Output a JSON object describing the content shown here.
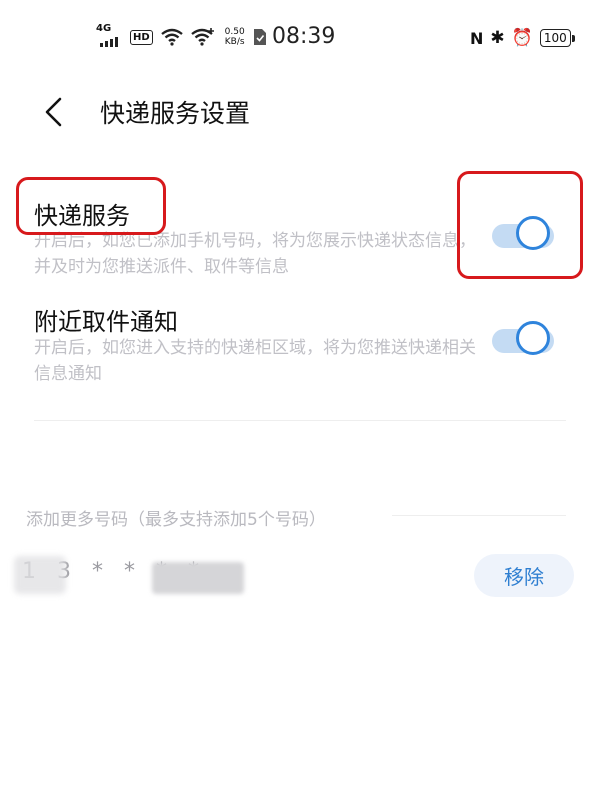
{
  "status_bar": {
    "network_type": "4G",
    "hd_badge": "HD",
    "speed_value": "0.50",
    "speed_unit": "KB/s",
    "time": "08:39",
    "battery_level": "100",
    "icons": [
      "signal-icon",
      "wifi-icon",
      "wifi-plus-icon",
      "sim-card-icon",
      "nfc-icon",
      "bluetooth-icon",
      "alarm-icon",
      "battery-icon"
    ]
  },
  "header": {
    "back_icon": "chevron-left-icon",
    "title": "快递服务设置"
  },
  "settings": [
    {
      "title": "快递服务",
      "description": "开启后，如您已添加手机号码，将为您展示快递状态信息，并及时为您推送派件、取件等信息",
      "enabled": true
    },
    {
      "title": "附近取件通知",
      "description": "开启后，如您进入支持的快递柜区域，将为您推送快递相关信息通知",
      "enabled": true
    }
  ],
  "phones": {
    "section_label": "添加更多号码（最多支持添加5个号码）",
    "items": [
      {
        "number": "1 3 * * * *",
        "remove_label": "移除"
      }
    ]
  },
  "colors": {
    "accent": "#2f84dc",
    "toggle_track": "#c4dbf3",
    "highlight_annotation": "#d7191c",
    "secondary_text": "#c0c0c6"
  }
}
